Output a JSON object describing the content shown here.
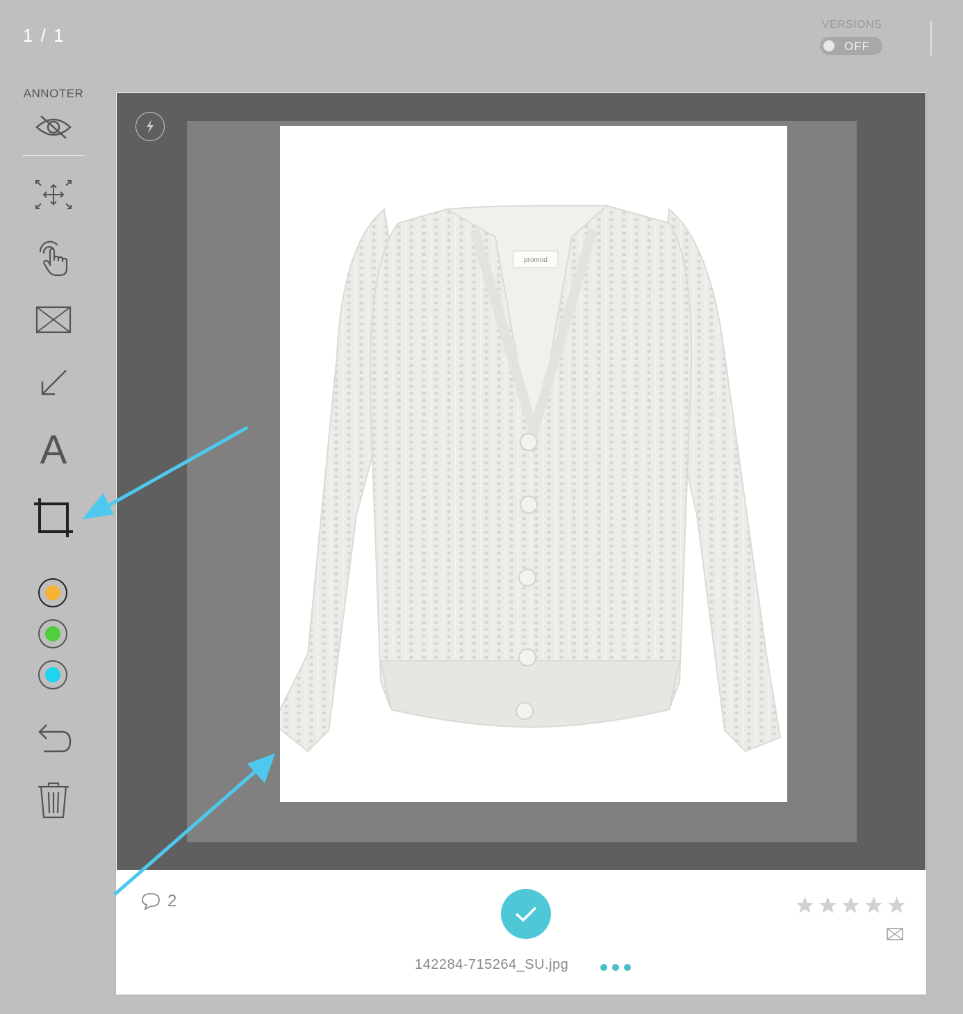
{
  "header": {
    "counter": "1 / 1",
    "versions_label": "VERSIONS",
    "versions_state": "OFF"
  },
  "toolbar": {
    "title": "ANNOTER",
    "tools": [
      "eye-off-icon",
      "move-icon",
      "hand-pointer-icon",
      "rectangle-icon",
      "arrow-icon",
      "text-icon",
      "crop-icon"
    ],
    "text_tool_glyph": "A",
    "colors": [
      "#f5b335",
      "#4fcf3d",
      "#1fd4ee"
    ],
    "actions": [
      "undo-icon",
      "trash-icon"
    ]
  },
  "viewer": {
    "photo_label": "promod"
  },
  "footer": {
    "comment_count": "2",
    "filename": "142284-715264_SU.jpg",
    "rating": 0,
    "rating_max": 5
  },
  "colors": {
    "accent": "#4ec8d7",
    "annotation_arrow": "#4fc8ee"
  }
}
